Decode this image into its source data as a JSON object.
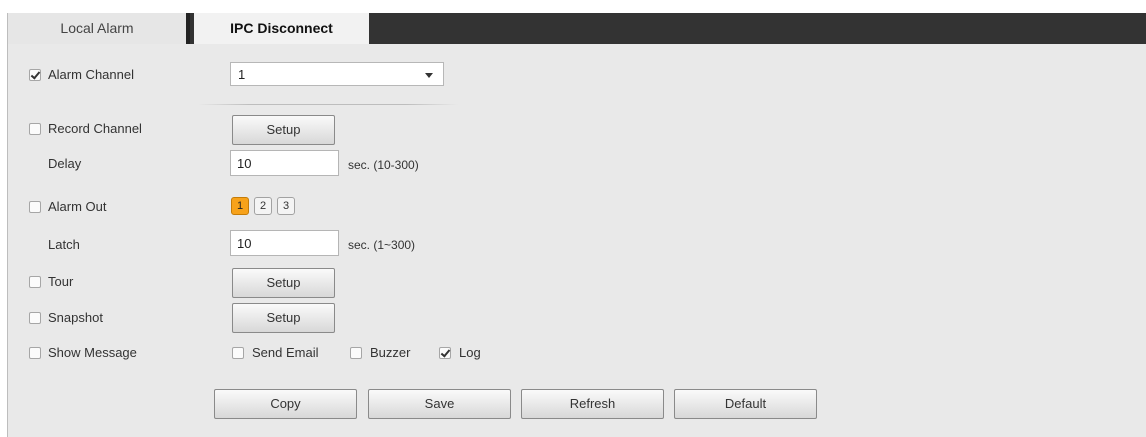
{
  "tabs": [
    {
      "label": "Local Alarm",
      "active": false
    },
    {
      "label": "IPC Disconnect",
      "active": true
    }
  ],
  "alarm_channel": {
    "label": "Alarm Channel",
    "checked": true,
    "value": "1"
  },
  "record_channel": {
    "label": "Record Channel",
    "checked": false,
    "button": "Setup"
  },
  "delay": {
    "label": "Delay",
    "value": "10",
    "unit": "sec. (10-300)"
  },
  "alarm_out": {
    "label": "Alarm Out",
    "checked": false,
    "outputs": [
      "1",
      "2",
      "3"
    ],
    "selected": "1"
  },
  "latch": {
    "label": "Latch",
    "value": "10",
    "unit": "sec. (1~300)"
  },
  "tour": {
    "label": "Tour",
    "checked": false,
    "button": "Setup"
  },
  "snapshot": {
    "label": "Snapshot",
    "checked": false,
    "button": "Setup"
  },
  "show_message": {
    "label": "Show Message",
    "checked": false
  },
  "send_email": {
    "label": "Send Email",
    "checked": false
  },
  "buzzer": {
    "label": "Buzzer",
    "checked": false
  },
  "log": {
    "label": "Log",
    "checked": true
  },
  "actions": {
    "copy": "Copy",
    "save": "Save",
    "refresh": "Refresh",
    "default": "Default"
  },
  "colors": {
    "tabbar": "#333333",
    "panel": "#e9e9e9",
    "highlight": "#f7a21a"
  }
}
